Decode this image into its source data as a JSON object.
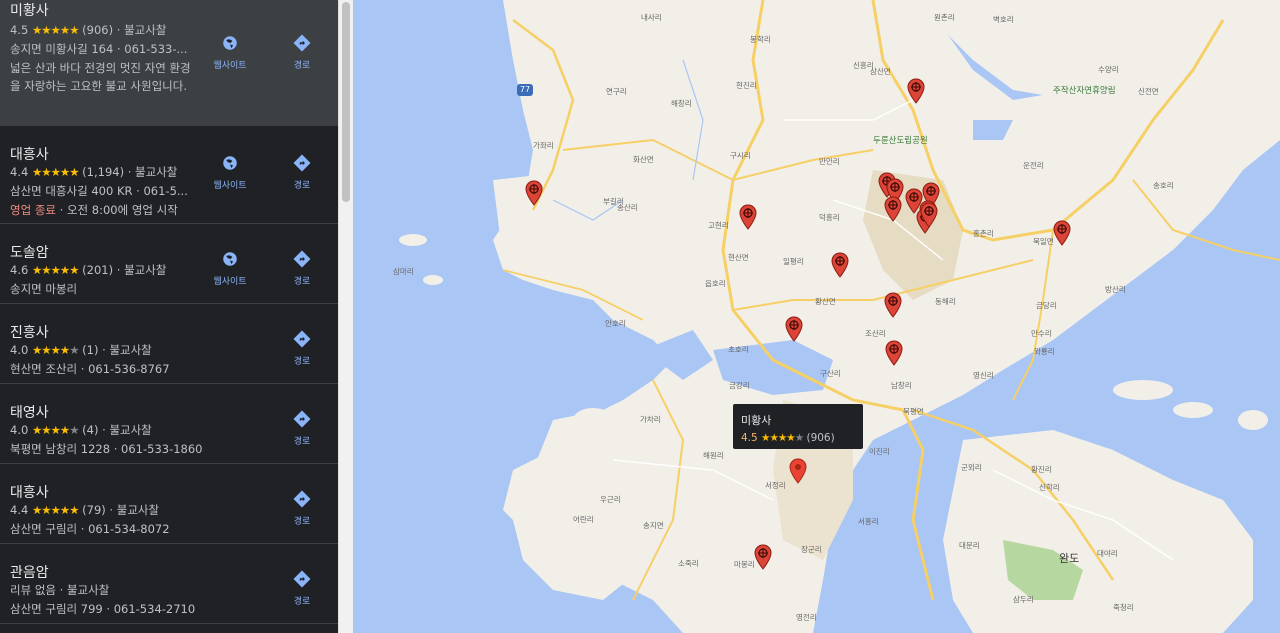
{
  "places": [
    {
      "name": "미황사",
      "rating": "4.5",
      "stars": 4.5,
      "reviews": "(906)",
      "category": "불교사찰",
      "address": "송지면 미황사길 164 · 061-533-...",
      "description": "넓은 산과 바다 전경의 멋진 자연 환경을 자랑하는 고요한 불교 사원입니다.",
      "website_label": "웹사이트",
      "directions_label": "경로"
    },
    {
      "name": "대흥사",
      "rating": "4.4",
      "stars": 4.5,
      "reviews": "(1,194)",
      "category": "불교사찰",
      "address": "삼산면 대흥사길 400 KR · 061-5...",
      "status": "영업 종료",
      "hours": "오전 8:00에 영업 시작",
      "website_label": "웹사이트",
      "directions_label": "경로"
    },
    {
      "name": "도솔암",
      "rating": "4.6",
      "stars": 4.5,
      "reviews": "(201)",
      "category": "불교사찰",
      "address": "송지면 마봉리",
      "website_label": "웹사이트",
      "directions_label": "경로"
    },
    {
      "name": "진흥사",
      "rating": "4.0",
      "stars": 4,
      "reviews": "(1)",
      "category": "불교사찰",
      "address": "현산면 조산리 · 061-536-8767",
      "directions_label": "경로"
    },
    {
      "name": "태영사",
      "rating": "4.0",
      "stars": 4,
      "reviews": "(4)",
      "category": "불교사찰",
      "address": "북평면 남창리 1228 · 061-533-1860",
      "directions_label": "경로"
    },
    {
      "name": "대흥사",
      "rating": "4.4",
      "stars": 4.5,
      "reviews": "(79)",
      "category": "불교사찰",
      "address": "삼산면 구림리 · 061-534-8072",
      "directions_label": "경로"
    },
    {
      "name": "관음암",
      "no_reviews": "리뷰 없음",
      "category": "불교사찰",
      "address": "삼산면 구림리 799 · 061-534-2710",
      "directions_label": "경로"
    }
  ],
  "map": {
    "road_badge": "77",
    "labels": [
      {
        "text": "주작산자연휴양림",
        "kind": "green"
      },
      {
        "text": "두륜산도립공원",
        "kind": "green"
      },
      {
        "text": "완도",
        "kind": "big"
      },
      {
        "text": "내사리"
      },
      {
        "text": "벽호리"
      },
      {
        "text": "수양리"
      },
      {
        "text": "봉학리"
      },
      {
        "text": "연구리"
      },
      {
        "text": "해창리"
      },
      {
        "text": "현진리"
      },
      {
        "text": "삼산면"
      },
      {
        "text": "신전면"
      },
      {
        "text": "가좌리"
      },
      {
        "text": "화산면"
      },
      {
        "text": "구시리"
      },
      {
        "text": "만안리"
      },
      {
        "text": "송호리"
      },
      {
        "text": "운전리"
      },
      {
        "text": "고현리"
      },
      {
        "text": "덕흥리"
      },
      {
        "text": "홍촌리"
      },
      {
        "text": "북일면"
      },
      {
        "text": "송산리"
      },
      {
        "text": "부길리"
      },
      {
        "text": "현산면"
      },
      {
        "text": "일평리"
      },
      {
        "text": "삼마리"
      },
      {
        "text": "읍호리"
      },
      {
        "text": "황산면"
      },
      {
        "text": "동해리"
      },
      {
        "text": "방산리"
      },
      {
        "text": "안호리"
      },
      {
        "text": "조산리"
      },
      {
        "text": "만수리"
      },
      {
        "text": "초호리"
      },
      {
        "text": "구산리"
      },
      {
        "text": "와룡리"
      },
      {
        "text": "금강리"
      },
      {
        "text": "남창리"
      },
      {
        "text": "영신리"
      },
      {
        "text": "가차리"
      },
      {
        "text": "북평면"
      },
      {
        "text": "이진리"
      },
      {
        "text": "군외리"
      },
      {
        "text": "황진리"
      },
      {
        "text": "해원리"
      },
      {
        "text": "서정리"
      },
      {
        "text": "우근리"
      },
      {
        "text": "신학리"
      },
      {
        "text": "어란리"
      },
      {
        "text": "송지면"
      },
      {
        "text": "서홍리"
      },
      {
        "text": "대문리"
      },
      {
        "text": "대야리"
      },
      {
        "text": "소죽리"
      },
      {
        "text": "마봉리"
      },
      {
        "text": "삼두리"
      },
      {
        "text": "죽청리"
      },
      {
        "text": "영전리"
      },
      {
        "text": "장군리"
      },
      {
        "text": "신흥리"
      },
      {
        "text": "금당리"
      },
      {
        "text": "원촌리"
      }
    ]
  },
  "tooltip": {
    "name": "미황사",
    "rating": "4.5",
    "stars": 4.5,
    "reviews": "(906)"
  },
  "colors": {
    "water": "#aac6f5",
    "land": "#f2efe9",
    "park": "#e6dcc3",
    "road": "#f6cf65",
    "pin": "#db4437",
    "sidebar": "#202124",
    "link": "#8ab4f8"
  }
}
